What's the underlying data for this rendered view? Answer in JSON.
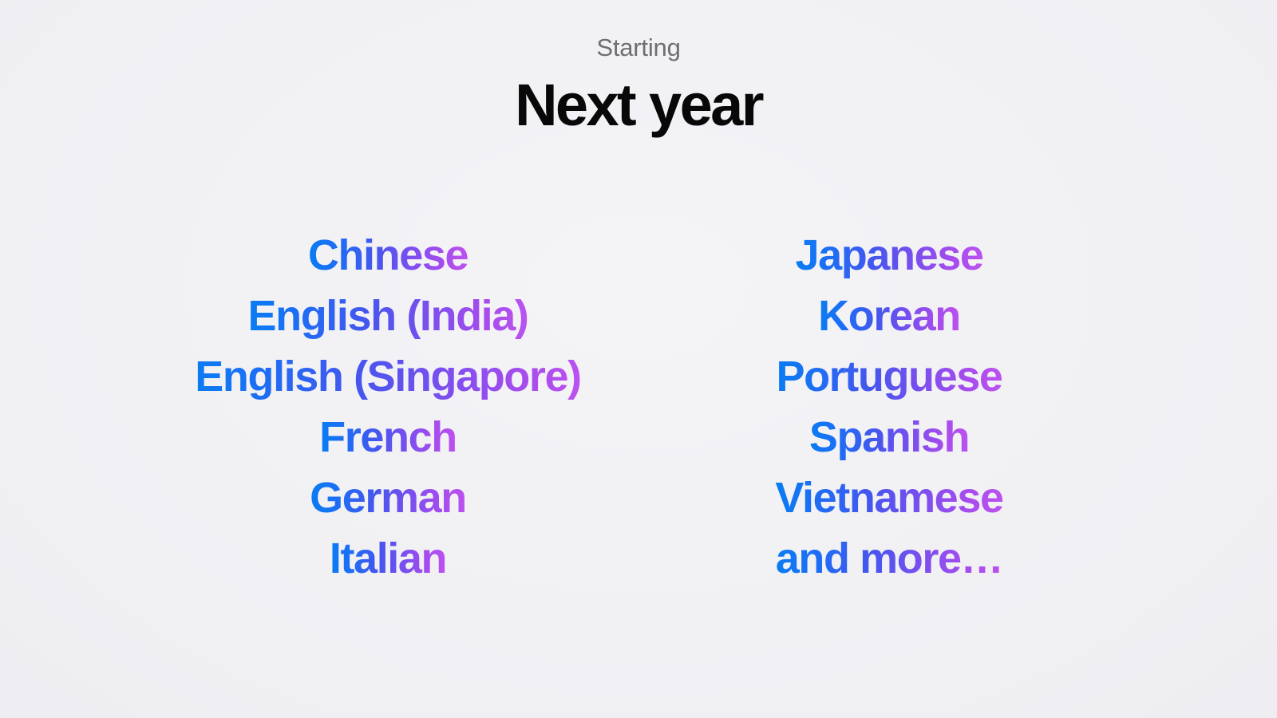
{
  "slide": {
    "background_color": "#f2f2f5",
    "header": {
      "eyebrow": "Starting",
      "eyebrow_color": "#6e6e73",
      "headline": "Next year",
      "headline_color": "#080808"
    },
    "gradient": {
      "start_color": "#0a7cf2",
      "mid_color": "#4556ee",
      "end_color": "#bb52ef"
    },
    "language_columns": [
      {
        "name": "left-column",
        "items": [
          "Chinese",
          "English (India)",
          "English (Singapore)",
          "French",
          "German",
          "Italian"
        ]
      },
      {
        "name": "right-column",
        "items": [
          "Japanese",
          "Korean",
          "Portuguese",
          "Spanish",
          "Vietnamese",
          "and more…"
        ]
      }
    ]
  }
}
